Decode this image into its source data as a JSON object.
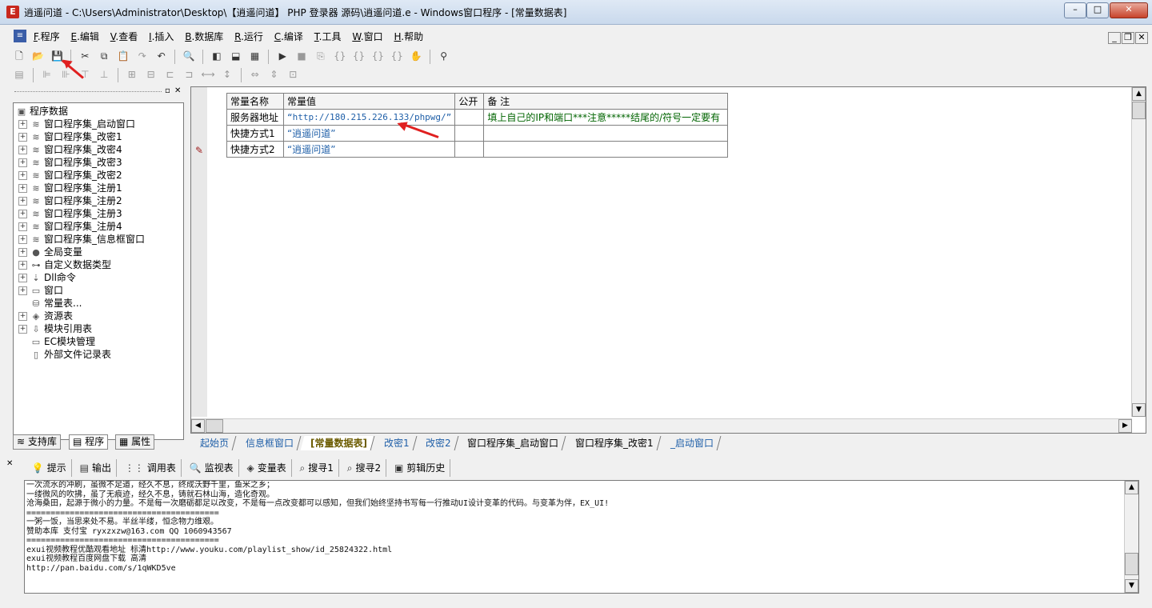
{
  "window": {
    "title": "逍遥问道 - C:\\Users\\Administrator\\Desktop\\【逍遥问道】 PHP 登录器 源码\\逍遥问道.e - Windows窗口程序 - [常量数据表]"
  },
  "menu": [
    {
      "key": "F",
      "label": ".程序"
    },
    {
      "key": "E",
      "label": ".编辑"
    },
    {
      "key": "V",
      "label": ".查看"
    },
    {
      "key": "I",
      "label": ".插入"
    },
    {
      "key": "B",
      "label": ".数据库"
    },
    {
      "key": "R",
      "label": ".运行"
    },
    {
      "key": "C",
      "label": ".编译"
    },
    {
      "key": "T",
      "label": ".工具"
    },
    {
      "key": "W",
      "label": ".窗口"
    },
    {
      "key": "H",
      "label": ".帮助"
    }
  ],
  "tree": {
    "root": "程序数据",
    "items": [
      "窗口程序集_启动窗口",
      "窗口程序集_改密1",
      "窗口程序集_改密4",
      "窗口程序集_改密3",
      "窗口程序集_改密2",
      "窗口程序集_注册1",
      "窗口程序集_注册2",
      "窗口程序集_注册3",
      "窗口程序集_注册4",
      "窗口程序集_信息框窗口",
      "全局变量",
      "自定义数据类型",
      "Dll命令",
      "窗口",
      "常量表...",
      "资源表",
      "模块引用表",
      "EC模块管理",
      "外部文件记录表"
    ]
  },
  "left_tabs": [
    "支持库",
    "程序",
    "属性"
  ],
  "const_table": {
    "headers": [
      "常量名称",
      "常量值",
      "公开",
      "备 注"
    ],
    "rows": [
      {
        "name": "服务器地址",
        "value": "“http://180.215.226.133/phpwg/”",
        "public": "",
        "note": "填上自己的IP和端口***注意*****结尾的/符号一定要有"
      },
      {
        "name": "快捷方式1",
        "value": "“逍遥问道”",
        "public": "",
        "note": ""
      },
      {
        "name": "快捷方式2",
        "value": "“逍遥问道”",
        "public": "",
        "note": ""
      }
    ]
  },
  "doc_tabs": [
    "起始页",
    "信息框窗口",
    "[常量数据表]",
    "改密1",
    "改密2",
    "窗口程序集_启动窗口",
    "窗口程序集_改密1",
    "_启动窗口"
  ],
  "bottom_tabs": [
    "提示",
    "输出",
    "调用表",
    "监视表",
    "变量表",
    "搜寻1",
    "搜寻2",
    "剪辑历史"
  ],
  "output_lines": [
    "一次流水的冲刷，虽微不足道，经久不息，终成沃野千里，鱼米之乡；",
    "一缕微风的吹拂，虽了无痕迹，经久不息，铸就石林山海，造化奇观。",
    "沧海桑田，起源于微小的力量。不是每一次磨砺都足以改变，不是每一点改变都可以感知，但我们始终坚持书写每一行推动UI设计变革的代码。与变革为伴，EX_UI!",
    "========================================",
    "一粥一饭，当思来处不易。半丝半缕，恒念物力维艰。",
    "赞助本库 支付宝 ryxzxzw@163.com QQ 1060943567",
    "========================================",
    "exui视频教程优酷观看地址 标清http://www.youku.com/playlist_show/id_25824322.html",
    "exui视频教程百度网盘下载 高清",
    "http://pan.baidu.com/s/1qWKD5ve"
  ]
}
